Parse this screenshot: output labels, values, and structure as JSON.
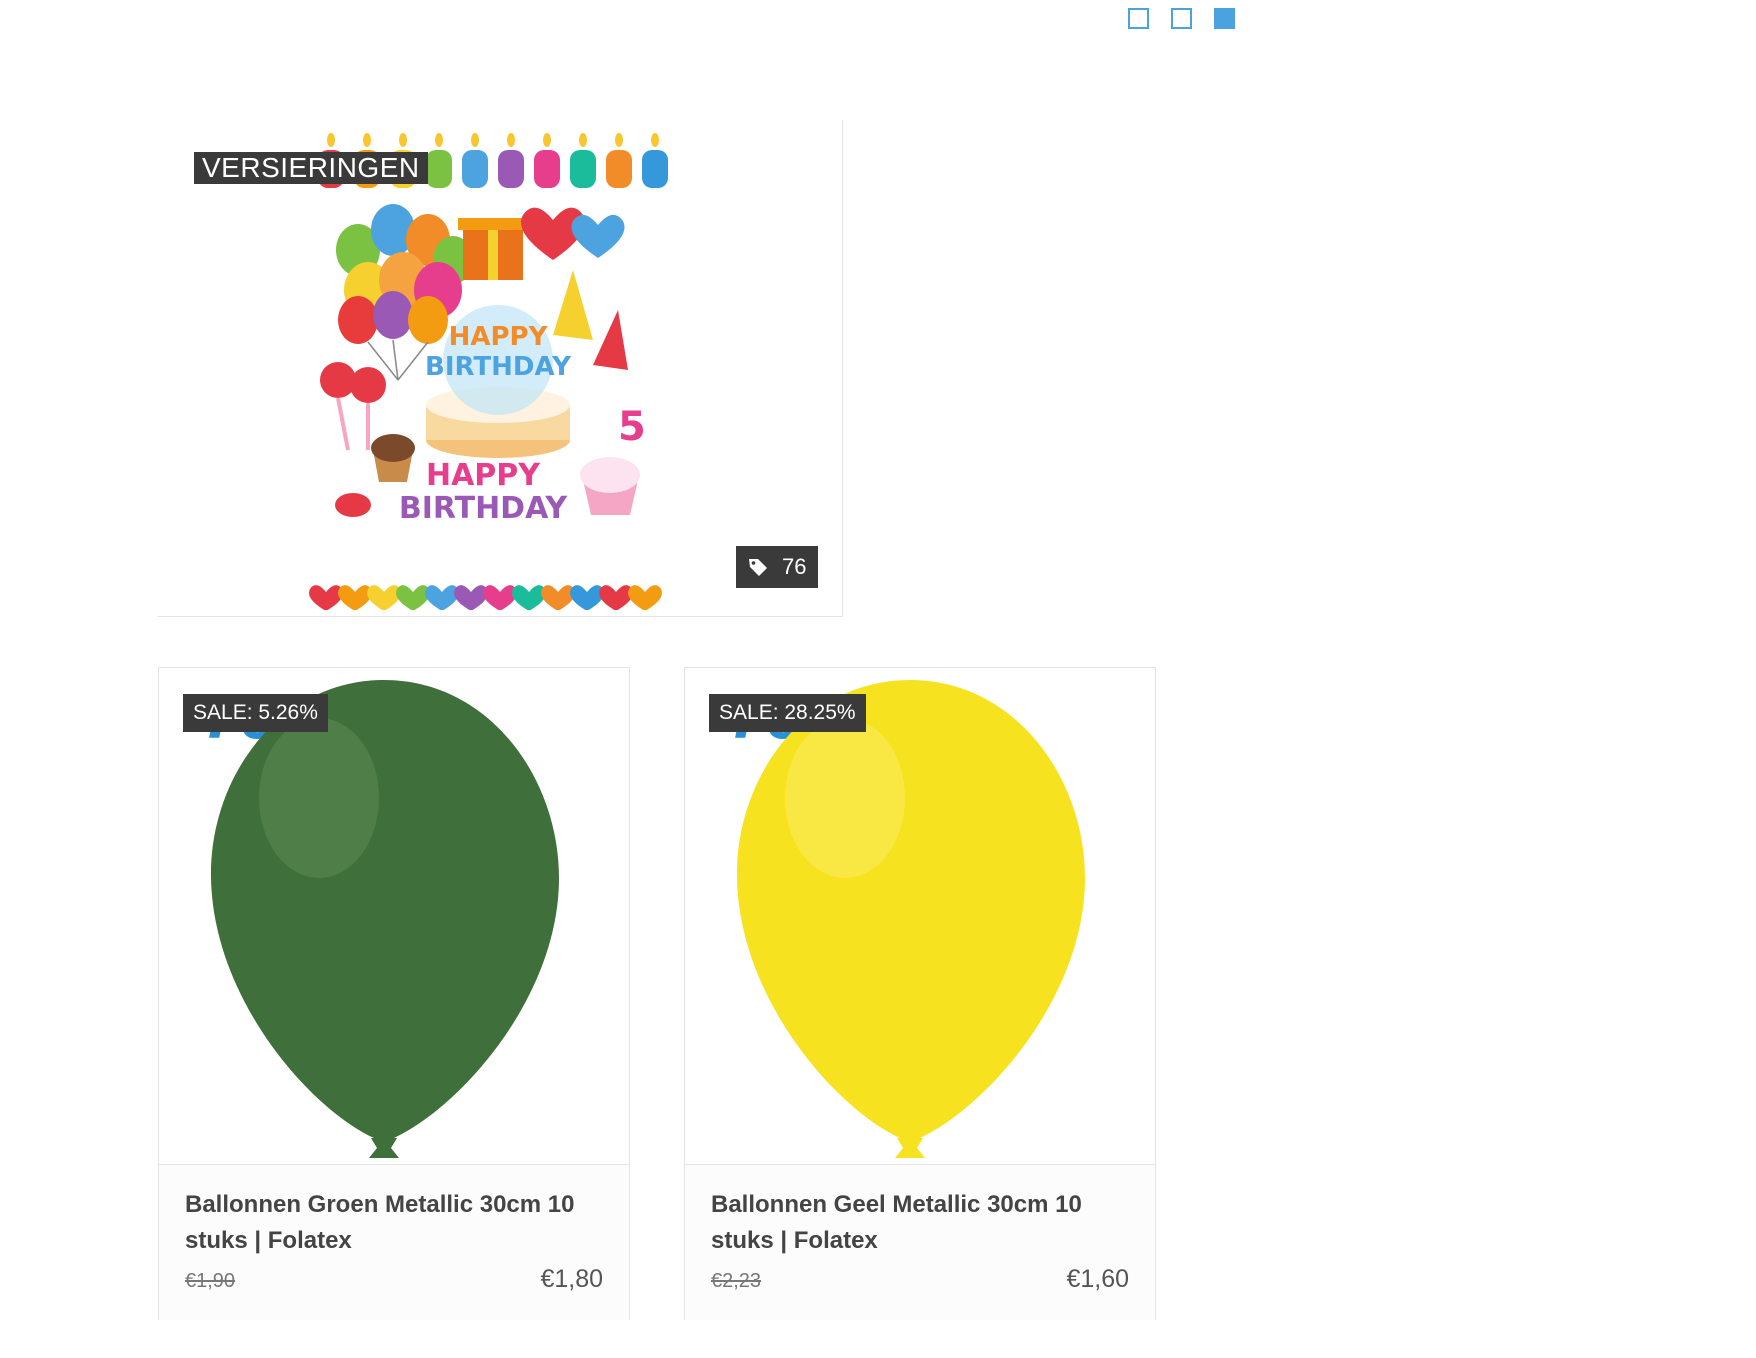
{
  "pager": {
    "count": 3,
    "active_index": 2
  },
  "category": {
    "label": "VERSIERINGEN",
    "count": "76",
    "image_icon": "birthday-decorations-image",
    "count_icon": "tag-icon"
  },
  "products": [
    {
      "sale": "SALE: 5.26%",
      "title": "Ballonnen Groen Metallic 30cm 10 stuks | Folatex",
      "old_price": "€1,90",
      "price": "€1,80",
      "balloon_color": "#3f6f3a",
      "balloon_highlight": "#6f9a68",
      "brand_text": "Folatex"
    },
    {
      "sale": "SALE: 28.25%",
      "title": "Ballonnen Geel Metallic 30cm 10 stuks | Folatex",
      "old_price": "€2,23",
      "price": "€1,60",
      "balloon_color": "#f7e21f",
      "balloon_highlight": "#fdf48a",
      "brand_text": "Folatex"
    }
  ],
  "colors": {
    "accent": "#4aa3df",
    "badge_bg": "#3a3a3a"
  }
}
